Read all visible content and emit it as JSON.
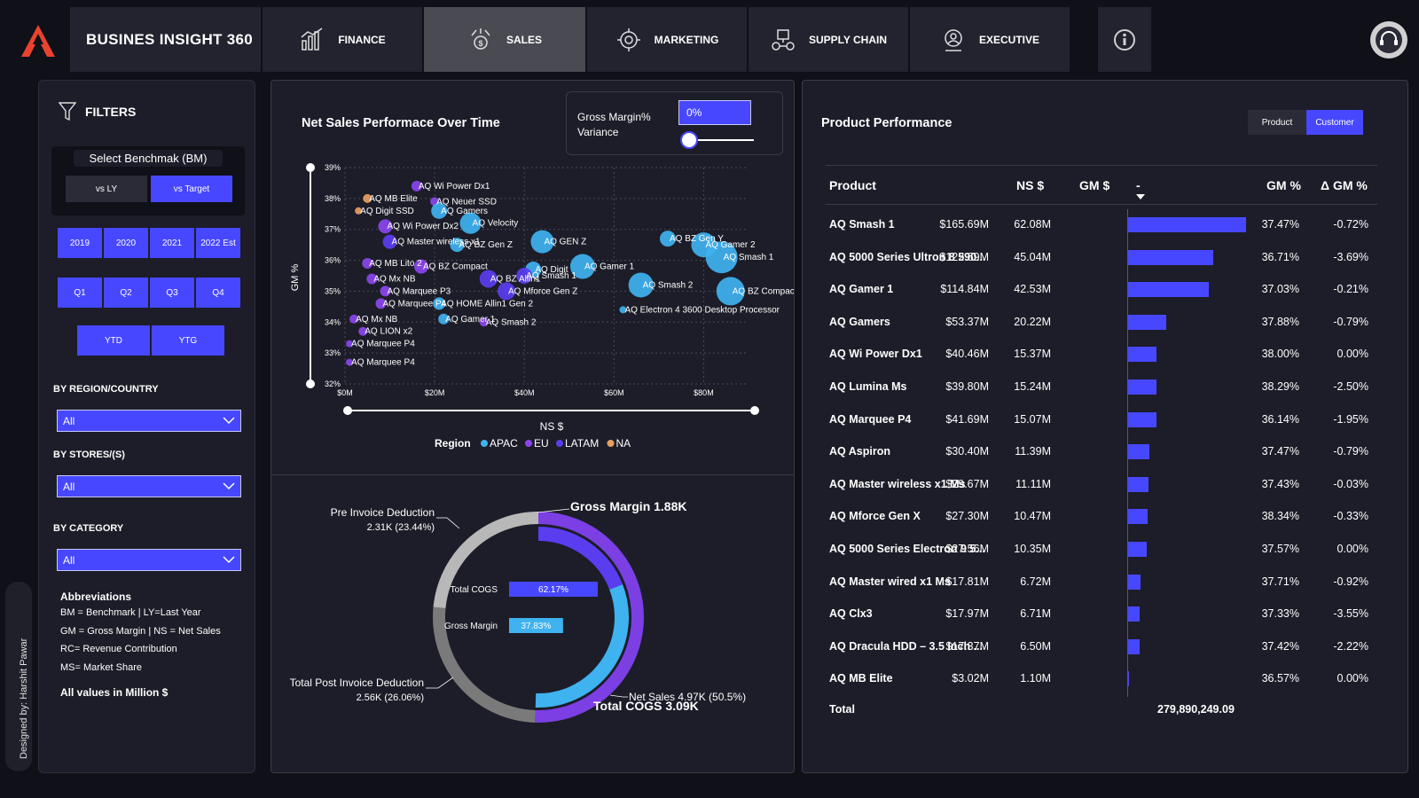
{
  "header": {
    "brand": "BUSINES INSIGHT 360",
    "tabs": [
      {
        "label": "FINANCE",
        "icon": "finance-icon"
      },
      {
        "label": "SALES",
        "icon": "sales-icon",
        "active": true
      },
      {
        "label": "MARKETING",
        "icon": "marketing-icon"
      },
      {
        "label": "SUPPLY CHAIN",
        "icon": "supply-chain-icon"
      },
      {
        "label": "EXECUTIVE",
        "icon": "executive-icon"
      }
    ]
  },
  "designer": "Designed by: Harshit Pawar",
  "filters": {
    "title": "FILTERS",
    "benchmark_label": "Select Benchmak (BM)",
    "benchmark_options": [
      "vs LY",
      "vs Target"
    ],
    "benchmark_selected": "vs Target",
    "years": [
      "2019",
      "2020",
      "2021",
      "2022 Est"
    ],
    "quarters": [
      "Q1",
      "Q2",
      "Q3",
      "Q4"
    ],
    "periods": [
      "YTD",
      "YTG"
    ],
    "region_label": "BY REGION/COUNTRY",
    "region_value": "All",
    "stores_label": "BY STORES/(S)",
    "stores_value": "All",
    "category_label": "BY CATEGORY",
    "category_value": "All",
    "abbreviations_title": "Abbreviations",
    "abbreviations": [
      "BM = Benchmark | LY=Last Year",
      "GM = Gross Margin | NS = Net Sales",
      "RC= Revenue Contribution",
      "MS= Market Share"
    ],
    "units_note": "All values in Million $"
  },
  "scatter": {
    "title": "Net Sales Performace Over Time",
    "gm_variance_label_1": "Gross Margin%",
    "gm_variance_label_2": "Variance",
    "gm_variance_value": "0%",
    "legend_title": "Region",
    "legend": [
      {
        "name": "APAC",
        "color": "#3fb2f0"
      },
      {
        "name": "EU",
        "color": "#8a45ee"
      },
      {
        "name": "LATAM",
        "color": "#5b3df0"
      },
      {
        "name": "NA",
        "color": "#e8a060"
      }
    ]
  },
  "chart_data": [
    {
      "type": "scatter",
      "title": "Net Sales Performace Over Time",
      "xlabel": "NS $",
      "ylabel": "GM %",
      "xlim": [
        0,
        90
      ],
      "ylim": [
        32,
        39
      ],
      "x_ticks": [
        "$0M",
        "$20M",
        "$40M",
        "$60M",
        "$80M"
      ],
      "y_ticks": [
        "32%",
        "33%",
        "34%",
        "35%",
        "36%",
        "37%",
        "38%",
        "39%"
      ],
      "grid": true,
      "legend_position": "bottom",
      "points": [
        {
          "label": "AQ Wi Power Dx1",
          "x": 16,
          "y": 38.4,
          "region": "EU",
          "size": 6
        },
        {
          "label": "AQ MB Elite",
          "x": 5,
          "y": 38.0,
          "region": "NA",
          "size": 5
        },
        {
          "label": "AQ Neuer SSD",
          "x": 20,
          "y": 37.9,
          "region": "EU",
          "size": 5
        },
        {
          "label": "AQ Digit SSD",
          "x": 3,
          "y": 37.6,
          "region": "NA",
          "size": 4
        },
        {
          "label": "AQ Gamers",
          "x": 21,
          "y": 37.6,
          "region": "APAC",
          "size": 9
        },
        {
          "label": "AQ Velocity",
          "x": 28,
          "y": 37.2,
          "region": "APAC",
          "size": 12
        },
        {
          "label": "AQ Wi Power Dx2",
          "x": 9,
          "y": 37.1,
          "region": "EU",
          "size": 8
        },
        {
          "label": "AQ Master wireless x1",
          "x": 10,
          "y": 36.6,
          "region": "LATAM",
          "size": 8
        },
        {
          "label": "AQ BZ Gen Z",
          "x": 25,
          "y": 36.5,
          "region": "APAC",
          "size": 8
        },
        {
          "label": "AQ GEN Z",
          "x": 44,
          "y": 36.6,
          "region": "APAC",
          "size": 13
        },
        {
          "label": "AQ BZ Gen Y",
          "x": 72,
          "y": 36.7,
          "region": "APAC",
          "size": 9
        },
        {
          "label": "AQ Gamer 2",
          "x": 80,
          "y": 36.5,
          "region": "APAC",
          "size": 14
        },
        {
          "label": "AQ Smash 1",
          "x": 84,
          "y": 36.1,
          "region": "APAC",
          "size": 18
        },
        {
          "label": "AQ MB Lito 2",
          "x": 5,
          "y": 35.9,
          "region": "EU",
          "size": 6
        },
        {
          "label": "AQ BZ Compact",
          "x": 17,
          "y": 35.8,
          "region": "EU",
          "size": 8
        },
        {
          "label": "AQ Digit",
          "x": 42,
          "y": 35.7,
          "region": "APAC",
          "size": 9
        },
        {
          "label": "AQ Gamer 1",
          "x": 53,
          "y": 35.8,
          "region": "APAC",
          "size": 14
        },
        {
          "label": "AQ Mx NB",
          "x": 6,
          "y": 35.4,
          "region": "EU",
          "size": 6
        },
        {
          "label": "AQ BZ Allin1",
          "x": 32,
          "y": 35.4,
          "region": "LATAM",
          "size": 10
        },
        {
          "label": "AQ Smash 1",
          "x": 40,
          "y": 35.5,
          "region": "LATAM",
          "size": 9
        },
        {
          "label": "AQ Smash 2",
          "x": 66,
          "y": 35.2,
          "region": "APAC",
          "size": 14
        },
        {
          "label": "AQ BZ Compact",
          "x": 86,
          "y": 35.0,
          "region": "APAC",
          "size": 16
        },
        {
          "label": "AQ Marquee P3",
          "x": 9,
          "y": 35.0,
          "region": "EU",
          "size": 6
        },
        {
          "label": "AQ Mforce Gen Z",
          "x": 36,
          "y": 35.0,
          "region": "LATAM",
          "size": 10
        },
        {
          "label": "AQ Marquee P4",
          "x": 8,
          "y": 34.6,
          "region": "EU",
          "size": 6
        },
        {
          "label": "AQ HOME Allin1 Gen 2",
          "x": 21,
          "y": 34.6,
          "region": "APAC",
          "size": 7
        },
        {
          "label": "AQ Electron 4 3600 Desktop Processor",
          "x": 62,
          "y": 34.4,
          "region": "APAC",
          "size": 4
        },
        {
          "label": "AQ Mx NB",
          "x": 2,
          "y": 34.1,
          "region": "EU",
          "size": 5
        },
        {
          "label": "AQ Gamer 1",
          "x": 22,
          "y": 34.1,
          "region": "APAC",
          "size": 6
        },
        {
          "label": "AQ Smash 2",
          "x": 31,
          "y": 34.0,
          "region": "EU",
          "size": 5
        },
        {
          "label": "AQ LION x2",
          "x": 4,
          "y": 33.7,
          "region": "EU",
          "size": 5
        },
        {
          "label": "AQ Marquee P4",
          "x": 1,
          "y": 33.3,
          "region": "EU",
          "size": 4
        },
        {
          "label": "AQ Marquee P4",
          "x": 1,
          "y": 32.7,
          "region": "EU",
          "size": 4
        }
      ]
    },
    {
      "type": "pie",
      "subtype": "donut",
      "labels": [
        {
          "text": "Gross Margin 1.88K"
        },
        {
          "text": "Pre Invoice Deduction",
          "value": "2.31K (23.44%)"
        },
        {
          "text": "Total Post Invoice Deduction",
          "value": "2.56K (26.06%)"
        },
        {
          "text": "Net Sales 4.97K (50.5%)"
        },
        {
          "text": "Total COGS 3.09K"
        }
      ],
      "outer_ring": [
        {
          "name": "Net Sales",
          "value": 4.97,
          "color": "#7b3fe4"
        },
        {
          "name": "Total Post Invoice Deduction",
          "value": 2.56,
          "color": "#7a7a7a"
        },
        {
          "name": "Pre Invoice Deduction",
          "value": 2.31,
          "color": "#b8b8b8"
        }
      ],
      "inner_ring": [
        {
          "name": "Total COGS",
          "value": 3.09,
          "color": "#3fb2f0"
        },
        {
          "name": "Gross Margin",
          "value": 1.88,
          "color": "#5b3df0"
        }
      ],
      "bars": [
        {
          "name": "Total COGS",
          "value": 62.17,
          "label": "62.17%",
          "color": "#4747ff"
        },
        {
          "name": "Gross Margin",
          "value": 37.83,
          "label": "37.83%",
          "color": "#3fb2f0"
        }
      ]
    }
  ],
  "product": {
    "title": "Product Performance",
    "toggle": [
      "Product",
      "Customer"
    ],
    "toggle_selected": "Customer",
    "columns": [
      "Product",
      "NS $",
      "GM $",
      "-",
      "GM %",
      "Δ GM %"
    ],
    "rows": [
      {
        "name": "AQ Smash 1",
        "ns": "$165.69M",
        "gm": "62.08M",
        "bar": 62.08,
        "gmp": "37.47%",
        "dgm": "-0.72%"
      },
      {
        "name": "AQ 5000 Series Ultron 8 590...",
        "ns": "$122.69M",
        "gm": "45.04M",
        "bar": 45.04,
        "gmp": "36.71%",
        "dgm": "-3.69%"
      },
      {
        "name": "AQ Gamer 1",
        "ns": "$114.84M",
        "gm": "42.53M",
        "bar": 42.53,
        "gmp": "37.03%",
        "dgm": "-0.21%"
      },
      {
        "name": "AQ Gamers",
        "ns": "$53.37M",
        "gm": "20.22M",
        "bar": 20.22,
        "gmp": "37.88%",
        "dgm": "-0.79%"
      },
      {
        "name": "AQ Wi Power Dx1",
        "ns": "$40.46M",
        "gm": "15.37M",
        "bar": 15.37,
        "gmp": "38.00%",
        "dgm": "0.00%"
      },
      {
        "name": "AQ Lumina Ms",
        "ns": "$39.80M",
        "gm": "15.24M",
        "bar": 15.24,
        "gmp": "38.29%",
        "dgm": "-2.50%"
      },
      {
        "name": "AQ Marquee P4",
        "ns": "$41.69M",
        "gm": "15.07M",
        "bar": 15.07,
        "gmp": "36.14%",
        "dgm": "-1.95%"
      },
      {
        "name": "AQ Aspiron",
        "ns": "$30.40M",
        "gm": "11.39M",
        "bar": 11.39,
        "gmp": "37.47%",
        "dgm": "-0.79%"
      },
      {
        "name": "AQ Master wireless x1 Ms",
        "ns": "$29.67M",
        "gm": "11.11M",
        "bar": 11.11,
        "gmp": "37.43%",
        "dgm": "-0.03%"
      },
      {
        "name": "AQ Mforce Gen X",
        "ns": "$27.30M",
        "gm": "10.47M",
        "bar": 10.47,
        "gmp": "38.34%",
        "dgm": "-0.33%"
      },
      {
        "name": "AQ 5000 Series Electron 9 5...",
        "ns": "$27.56M",
        "gm": "10.35M",
        "bar": 10.35,
        "gmp": "37.57%",
        "dgm": "0.00%"
      },
      {
        "name": "AQ Master wired x1 Ms",
        "ns": "$17.81M",
        "gm": "6.72M",
        "bar": 6.72,
        "gmp": "37.71%",
        "dgm": "-0.92%"
      },
      {
        "name": "AQ Clx3",
        "ns": "$17.97M",
        "gm": "6.71M",
        "bar": 6.71,
        "gmp": "37.33%",
        "dgm": "-3.55%"
      },
      {
        "name": "AQ Dracula HDD – 3.5 Inch ...",
        "ns": "$17.37M",
        "gm": "6.50M",
        "bar": 6.5,
        "gmp": "37.42%",
        "dgm": "-2.22%"
      },
      {
        "name": "AQ MB Elite",
        "ns": "$3.02M",
        "gm": "1.10M",
        "bar": 1.1,
        "gmp": "36.57%",
        "dgm": "0.00%"
      }
    ],
    "bar_max": 62.08,
    "total_label": "Total",
    "total_value": "279,890,249.09"
  },
  "colors": {
    "accent": "#4747ff",
    "apac": "#3fb2f0",
    "eu": "#8a45ee",
    "latam": "#5b3df0",
    "na": "#e8a060",
    "panel": "#1c1d28",
    "background": "#0f1018"
  }
}
